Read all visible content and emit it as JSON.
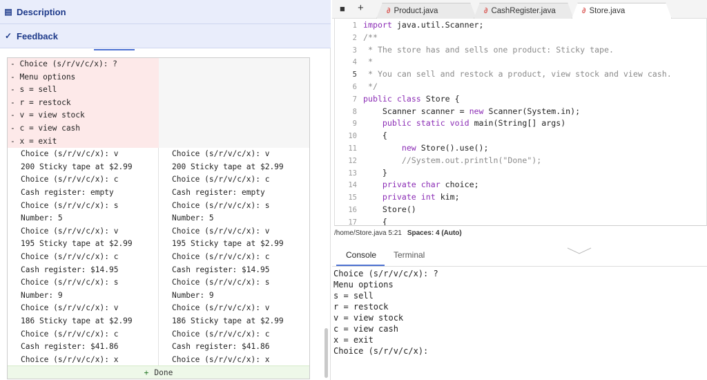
{
  "left": {
    "description_label": "Description",
    "feedback_label": "Feedback",
    "diff_left_deleted": [
      "- Choice (s/r/v/c/x): ?",
      "- Menu options",
      "- s = sell",
      "- r = restock",
      "- v = view stock",
      "- c = view cash",
      "- x = exit"
    ],
    "diff_common": [
      "Choice (s/r/v/c/x): v",
      "200 Sticky tape at $2.99",
      "Choice (s/r/v/c/x): c",
      "Cash register: empty",
      "Choice (s/r/v/c/x): s",
      "Number: 5",
      "Choice (s/r/v/c/x): v",
      "195 Sticky tape at $2.99",
      "Choice (s/r/v/c/x): c",
      "Cash register: $14.95",
      "Choice (s/r/v/c/x): s",
      "Number: 9",
      "Choice (s/r/v/c/x): v",
      "186 Sticky tape at $2.99",
      "Choice (s/r/v/c/x): c",
      "Cash register: $41.86",
      "Choice (s/r/v/c/x): x"
    ],
    "done_plus": "+",
    "done_label": "Done"
  },
  "editor": {
    "new_tab_label": "+",
    "tabs": [
      "Product.java",
      "CashRegister.java",
      "Store.java"
    ],
    "active_tab": "Store.java",
    "java_icon": "java-cup-icon",
    "lines": [
      {
        "n": "1",
        "t": "import java.util.Scanner;"
      },
      {
        "n": "2",
        "t": "/**"
      },
      {
        "n": "3",
        "t": " * The store has and sells one product: Sticky tape."
      },
      {
        "n": "4",
        "t": " *"
      },
      {
        "n": "5",
        "t": " * You can sell and restock a product, view stock and view cash."
      },
      {
        "n": "6",
        "t": " */"
      },
      {
        "n": "7",
        "t": "public class Store {"
      },
      {
        "n": "8",
        "t": "    Scanner scanner = new Scanner(System.in);"
      },
      {
        "n": "9",
        "t": "    public static void main(String[] args)"
      },
      {
        "n": "10",
        "t": "    {"
      },
      {
        "n": "11",
        "t": "        new Store().use();"
      },
      {
        "n": "12",
        "t": "        //System.out.println(\"Done\");"
      },
      {
        "n": "13",
        "t": "    }"
      },
      {
        "n": "14",
        "t": "    private char choice;"
      },
      {
        "n": "15",
        "t": "    private int kim;"
      },
      {
        "n": "16",
        "t": "    Store()"
      },
      {
        "n": "17",
        "t": "    {"
      }
    ],
    "current_line": "5",
    "status_path": "/home/Store.java 5:21",
    "status_spaces": "Spaces: 4 (Auto)"
  },
  "console": {
    "tab_console": "Console",
    "tab_terminal": "Terminal",
    "output": [
      "Choice (s/r/v/c/x): ?",
      "Menu options",
      "s = sell",
      "r = restock",
      "v = view stock",
      "c = view cash",
      "x = exit",
      "Choice (s/r/v/c/x):"
    ]
  },
  "colors": {
    "accent": "#4a6fd1",
    "header_bg": "#e9edfb",
    "deleted_bg": "#fde9e9",
    "added_bg": "#eef8e9",
    "keyword": "#8b2cb5"
  }
}
